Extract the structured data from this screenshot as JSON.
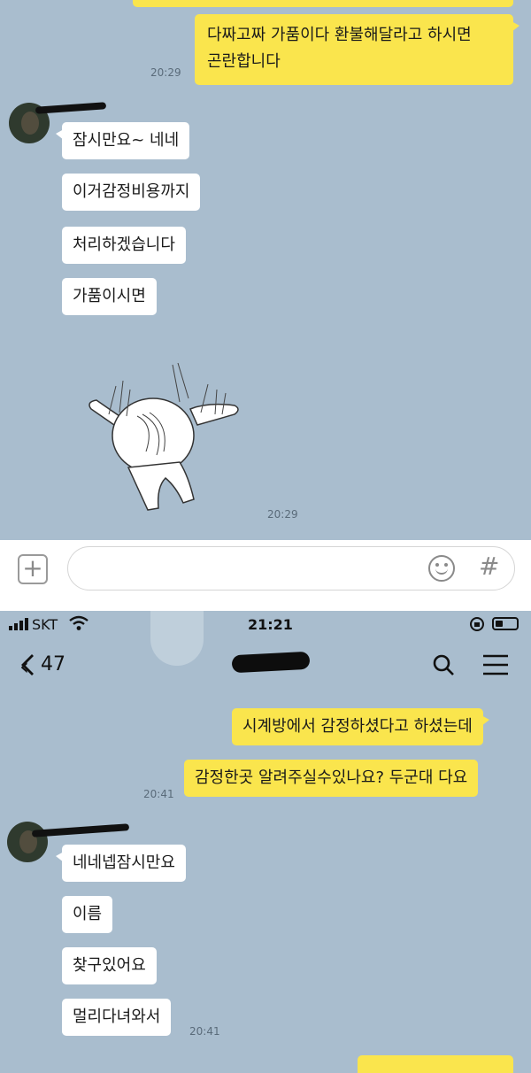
{
  "top_chat": {
    "messages_me": [
      {
        "text_line1": "다짜고짜 가품이다 환불해달라고 하시면",
        "text_line2": "곤란합니다",
        "time": "20:29"
      }
    ],
    "messages_them": [
      "잠시만요~ 네네",
      "이거감정비용까지",
      "처리하겠습니다",
      "가품이시면"
    ],
    "sticker_time": "20:29",
    "sticker": "dabbing-character-sticker"
  },
  "input_bar": {
    "plus_icon": "plus-icon",
    "emoji_icon": "smile-icon",
    "hash_label": "#"
  },
  "status_bar": {
    "carrier": "SKT",
    "time": "21:21",
    "battery_icon": "battery-icon",
    "wifi_icon": "wifi-icon"
  },
  "header": {
    "back_count": "47",
    "back_icon": "chevron-left-icon",
    "search_icon": "search-icon",
    "menu_icon": "menu-icon"
  },
  "bottom_chat": {
    "messages_me": [
      "시계방에서 감정하셨다고 하셨는데",
      "감정한곳 알려주실수있나요? 두군대 다요"
    ],
    "me_time": "20:41",
    "messages_them": [
      "네네넵잠시만요",
      "이름",
      "찾구있어요",
      "멀리다녀와서"
    ],
    "them_time": "20:41"
  },
  "colors": {
    "chat_bg": "#a9bdce",
    "my_bubble": "#fae54d",
    "their_bubble": "#ffffff"
  }
}
